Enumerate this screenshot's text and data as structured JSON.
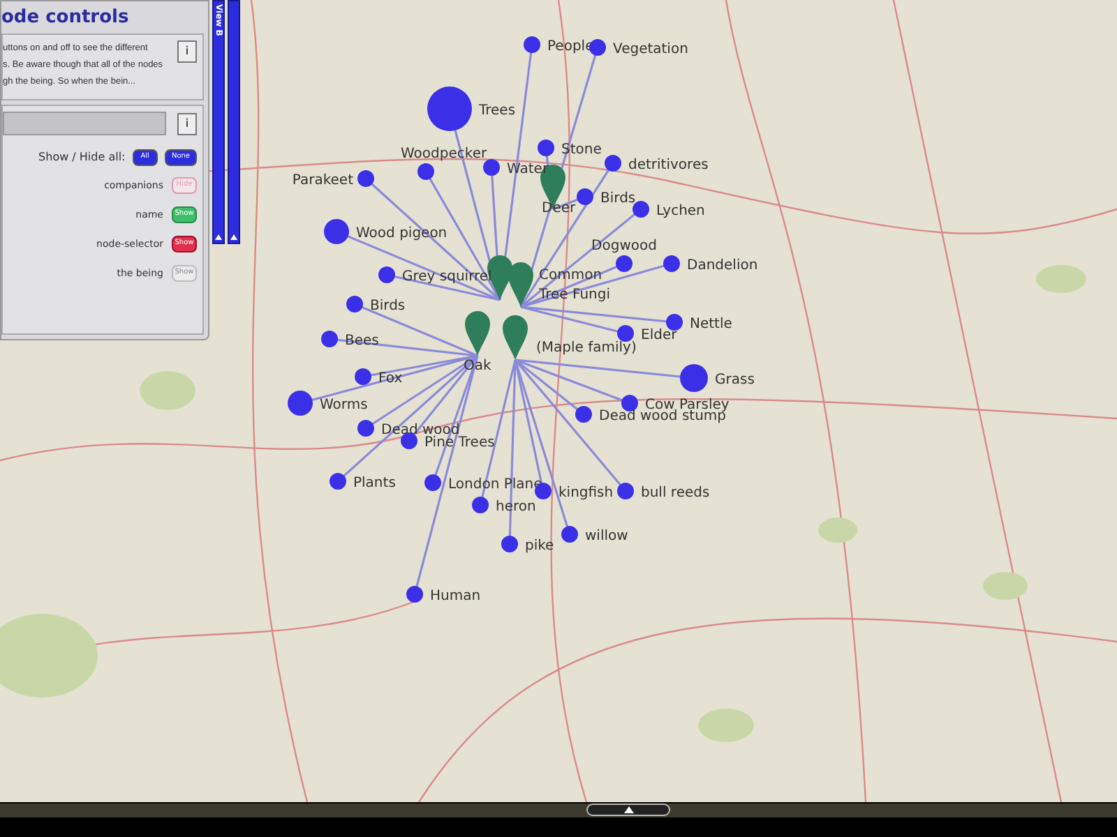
{
  "panel": {
    "title": "ode controls",
    "info_lines": [
      "uttons on and off to see the different",
      "s. Be aware though that all of the nodes",
      "gh the being. So when the bein..."
    ],
    "info_button": "i",
    "search_button": "i",
    "show_hide_label": "Show / Hide all:",
    "all_button": "All",
    "none_button": "None",
    "toggles": [
      {
        "label": "companions",
        "button": "Hide",
        "kind": "hide"
      },
      {
        "label": "name",
        "button": "Show",
        "kind": "green"
      },
      {
        "label": "node-selector",
        "button": "Show",
        "kind": "red"
      },
      {
        "label": "the being",
        "button": "Show",
        "kind": "faded"
      }
    ]
  },
  "side_tabs": [
    {
      "label": "View B"
    }
  ],
  "graph": {
    "nodes": [
      {
        "kind": "companion",
        "label": "People"
      },
      {
        "kind": "companion",
        "label": "Vegetation"
      },
      {
        "kind": "companion",
        "label": "Trees"
      },
      {
        "kind": "companion",
        "label": "Stone"
      },
      {
        "kind": "companion",
        "label": "Parakeet"
      },
      {
        "kind": "companion",
        "label": "Woodpecker"
      },
      {
        "kind": "companion",
        "label": "Water"
      },
      {
        "kind": "companion",
        "label": "detritivores"
      },
      {
        "kind": "companion",
        "label": "Birds"
      },
      {
        "kind": "companion",
        "label": "Lychen"
      },
      {
        "kind": "companion",
        "label": "Wood pigeon"
      },
      {
        "kind": "companion",
        "label": "Grey squirrel"
      },
      {
        "kind": "companion",
        "label": "Dogwood"
      },
      {
        "kind": "companion",
        "label": "Dandelion"
      },
      {
        "kind": "companion",
        "label": "Birds"
      },
      {
        "kind": "companion",
        "label": "Nettle"
      },
      {
        "kind": "companion",
        "label": "Bees"
      },
      {
        "kind": "companion",
        "label": "Elder"
      },
      {
        "kind": "companion",
        "label": "Grass"
      },
      {
        "kind": "companion",
        "label": "Fox"
      },
      {
        "kind": "companion",
        "label": "Worms"
      },
      {
        "kind": "companion",
        "label": "Cow Parsley"
      },
      {
        "kind": "companion",
        "label": "Dead wood"
      },
      {
        "kind": "companion",
        "label": "Dead wood stump"
      },
      {
        "kind": "companion",
        "label": "Pine Trees"
      },
      {
        "kind": "companion",
        "label": "Plants"
      },
      {
        "kind": "companion",
        "label": "London Plane"
      },
      {
        "kind": "companion",
        "label": "heron"
      },
      {
        "kind": "companion",
        "label": "kingfish"
      },
      {
        "kind": "companion",
        "label": "bull reeds"
      },
      {
        "kind": "companion",
        "label": "willow"
      },
      {
        "kind": "companion",
        "label": "pike"
      },
      {
        "kind": "companion",
        "label": "Human"
      },
      {
        "kind": "being",
        "label": "Deer"
      },
      {
        "kind": "being",
        "label": "Common"
      },
      {
        "kind": "being",
        "label": "Tree Fungi"
      },
      {
        "kind": "being",
        "label": "Oak"
      },
      {
        "kind": "being",
        "label": "(Maple family)"
      }
    ]
  }
}
